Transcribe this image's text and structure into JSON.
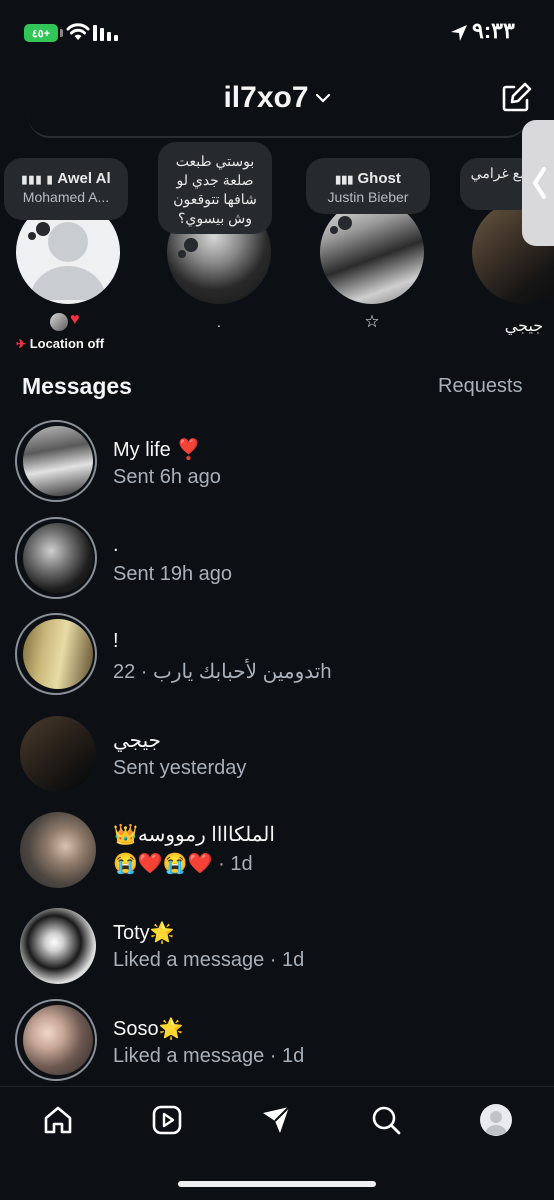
{
  "status_bar": {
    "time": "٩:٣٣",
    "battery_text": "٤٥+"
  },
  "header": {
    "title": "il7xo7"
  },
  "notes": [
    {
      "line1": "Awel Al",
      "line2": "Mohamed A..."
    },
    {
      "text": "بوستي طبعت صلعة جدي لو شافها تتوقعون وش بيسوي؟",
      "label": "."
    },
    {
      "line1": "Ghost",
      "line2": "Justin Bieber",
      "label": "☆"
    },
    {
      "text": "شجر مع غرامي",
      "label": "جيجي"
    }
  ],
  "my_note": {
    "location_text": "Location off"
  },
  "messages": {
    "title": "Messages",
    "requests": "Requests",
    "items": [
      {
        "name": "My life ❣️",
        "sub": "Sent 6h ago"
      },
      {
        "name": ".",
        "sub": "Sent 19h ago"
      },
      {
        "name": "!",
        "sub": "تدومين لأحبابك يارب · 22h"
      },
      {
        "name": "جيجي",
        "sub": "Sent yesterday"
      },
      {
        "name": "الملكاااا رمووسه👑",
        "sub": "😭❤️😭❤️ · 1d"
      },
      {
        "name": "Toty🌟",
        "sub": "Liked a message · 1d"
      },
      {
        "name": "Soso🌟",
        "sub": "Liked a message · 1d"
      }
    ]
  },
  "tabs": [
    "home",
    "reels",
    "messages",
    "search",
    "profile"
  ],
  "colors": {
    "background": "#0c1014",
    "bubble": "#262a2f",
    "muted": "#a8b0ba",
    "heart": "#ff3040"
  }
}
